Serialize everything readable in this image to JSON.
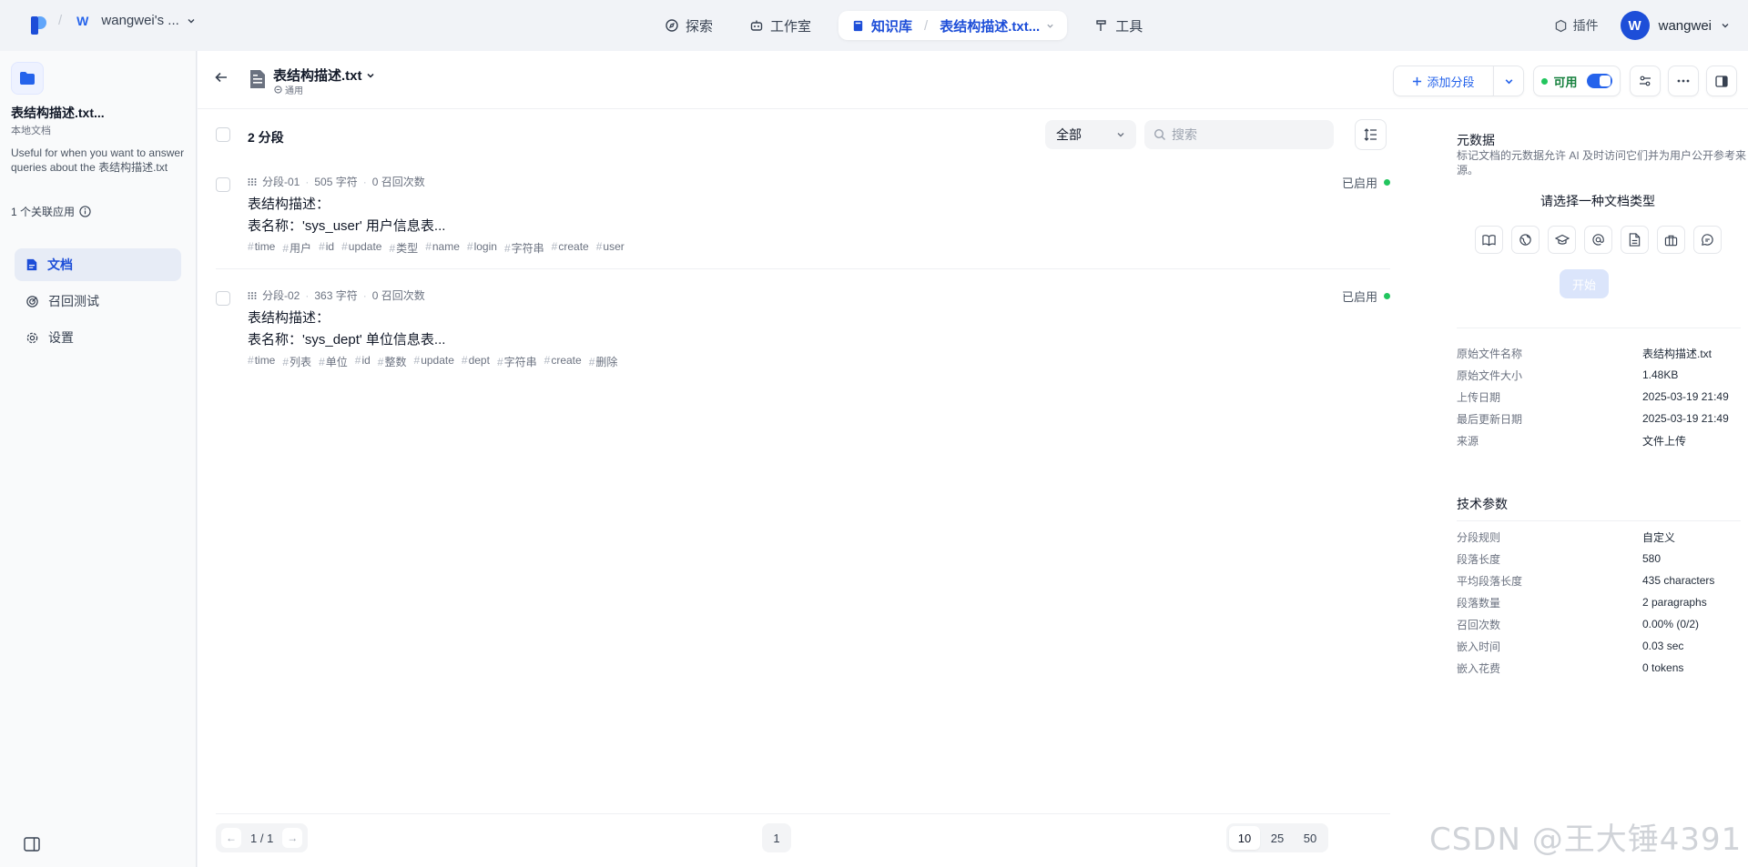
{
  "topnav": {
    "workspace_initial": "W",
    "workspace_name": "wangwei's ...",
    "items": [
      {
        "label": "探索"
      },
      {
        "label": "工作室"
      },
      {
        "label": "知识库",
        "current": "表结构描述.txt..."
      },
      {
        "label": "工具"
      }
    ],
    "plugin_label": "插件",
    "user_initial": "W",
    "user_name": "wangwei"
  },
  "sidebar": {
    "kb_title": "表结构描述.txt...",
    "kb_type": "本地文档",
    "kb_desc": "Useful for when you want to answer queries about the 表结构描述.txt",
    "linked_apps": "1 个关联应用",
    "nav": [
      {
        "label": "文档",
        "active": true
      },
      {
        "label": "召回测试"
      },
      {
        "label": "设置"
      }
    ]
  },
  "header": {
    "doc_name": "表结构描述.txt",
    "doc_mode": "通用",
    "add_segment": "添加分段",
    "status_label": "可用"
  },
  "list": {
    "count": "2 分段",
    "filter_value": "全部",
    "search_placeholder": "搜索",
    "segments": [
      {
        "id": "分段-01",
        "chars": "505 字符",
        "hits": "0 召回次数",
        "line1": "表结构描述：",
        "line2": "表名称：'sys_user' 用户信息表...",
        "status": "已启用",
        "tags": [
          "time",
          "用户",
          "id",
          "update",
          "类型",
          "name",
          "login",
          "字符串",
          "create",
          "user"
        ]
      },
      {
        "id": "分段-02",
        "chars": "363 字符",
        "hits": "0 召回次数",
        "line1": "表结构描述：",
        "line2": "表名称：'sys_dept' 单位信息表...",
        "status": "已启用",
        "tags": [
          "time",
          "列表",
          "单位",
          "id",
          "整数",
          "update",
          "dept",
          "字符串",
          "create",
          "删除"
        ]
      }
    ]
  },
  "pagination": {
    "page_info": "1 / 1",
    "current_page": "1",
    "sizes": [
      "10",
      "25",
      "50"
    ],
    "selected_size": "10"
  },
  "right_panel": {
    "meta_title": "元数据",
    "meta_desc": "标记文档的元数据允许 AI 及时访问它们并为用户公开参考来源。",
    "pick_type": "请选择一种文档类型",
    "type_icons": [
      "book-icon",
      "web-icon",
      "graduation-cap-icon",
      "at-sign-icon",
      "file-icon",
      "briefcase-icon",
      "chat-icon"
    ],
    "start_label": "开始",
    "file_info": [
      {
        "k": "原始文件名称",
        "v": "表结构描述.txt"
      },
      {
        "k": "原始文件大小",
        "v": "1.48KB"
      },
      {
        "k": "上传日期",
        "v": "2025-03-19 21:49"
      },
      {
        "k": "最后更新日期",
        "v": "2025-03-19 21:49"
      },
      {
        "k": "来源",
        "v": "文件上传"
      }
    ],
    "tech_title": "技术参数",
    "tech": [
      {
        "k": "分段规则",
        "v": "自定义"
      },
      {
        "k": "段落长度",
        "v": "580"
      },
      {
        "k": "平均段落长度",
        "v": "435 characters"
      },
      {
        "k": "段落数量",
        "v": "2 paragraphs"
      },
      {
        "k": "召回次数",
        "v": "0.00% (0/2)"
      },
      {
        "k": "嵌入时间",
        "v": "0.03 sec"
      },
      {
        "k": "嵌入花费",
        "v": "0 tokens"
      }
    ]
  },
  "watermark": "CSDN @王大锤4391",
  "colors": {
    "accent": "#2563eb",
    "enabled": "#22c55e"
  }
}
